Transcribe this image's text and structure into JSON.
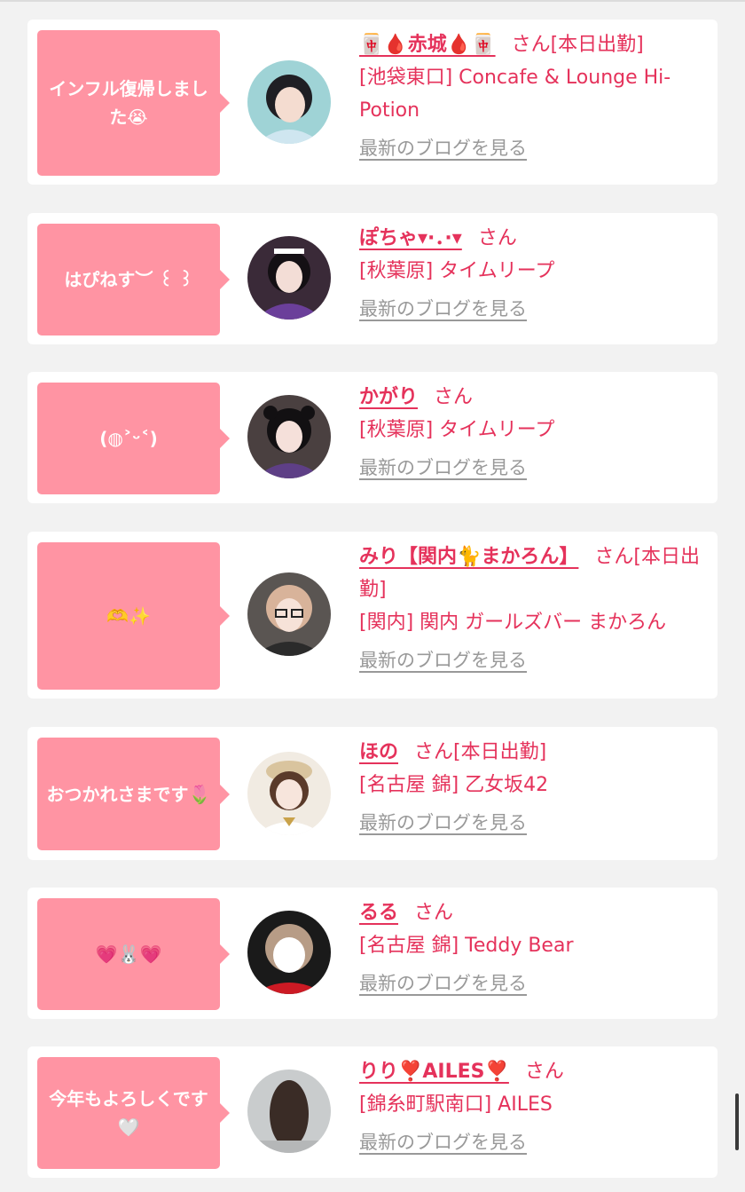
{
  "blog_link_label": "最新のブログを見る",
  "san_suffix": "さん",
  "entries": [
    {
      "bubble": "インフル復帰しました😭",
      "name": "🀄🩸赤城🩸🀄",
      "status": "[本日出勤]",
      "shop": "[池袋東口] Concafe & Lounge Hi-Potion"
    },
    {
      "bubble": "はぴねす︶ ꒰ ꒱",
      "name": "ぽちゃ▾·．·▾",
      "status": "",
      "shop": "[秋葉原] タイムリープ"
    },
    {
      "bubble": "(◍˃ᵕ˂)",
      "name": "かがり",
      "status": "",
      "shop": "[秋葉原] タイムリープ"
    },
    {
      "bubble": "🫶✨",
      "name": "みり【関内🐈まかろん】",
      "status": "[本日出勤]",
      "shop": "[関内] 関内 ガールズバー まかろん"
    },
    {
      "bubble": "おつかれさまです🌷",
      "name": "ほの",
      "status": "[本日出勤]",
      "shop": "[名古屋 錦] 乙女坂42"
    },
    {
      "bubble": "💗🐰💗",
      "name": "るる",
      "status": "",
      "shop": "[名古屋 錦] Teddy Bear"
    },
    {
      "bubble": "今年もよろしくです🤍",
      "name": "りり❣️AILES❣️",
      "status": "",
      "shop": "[錦糸町駅南口] AILES"
    }
  ]
}
